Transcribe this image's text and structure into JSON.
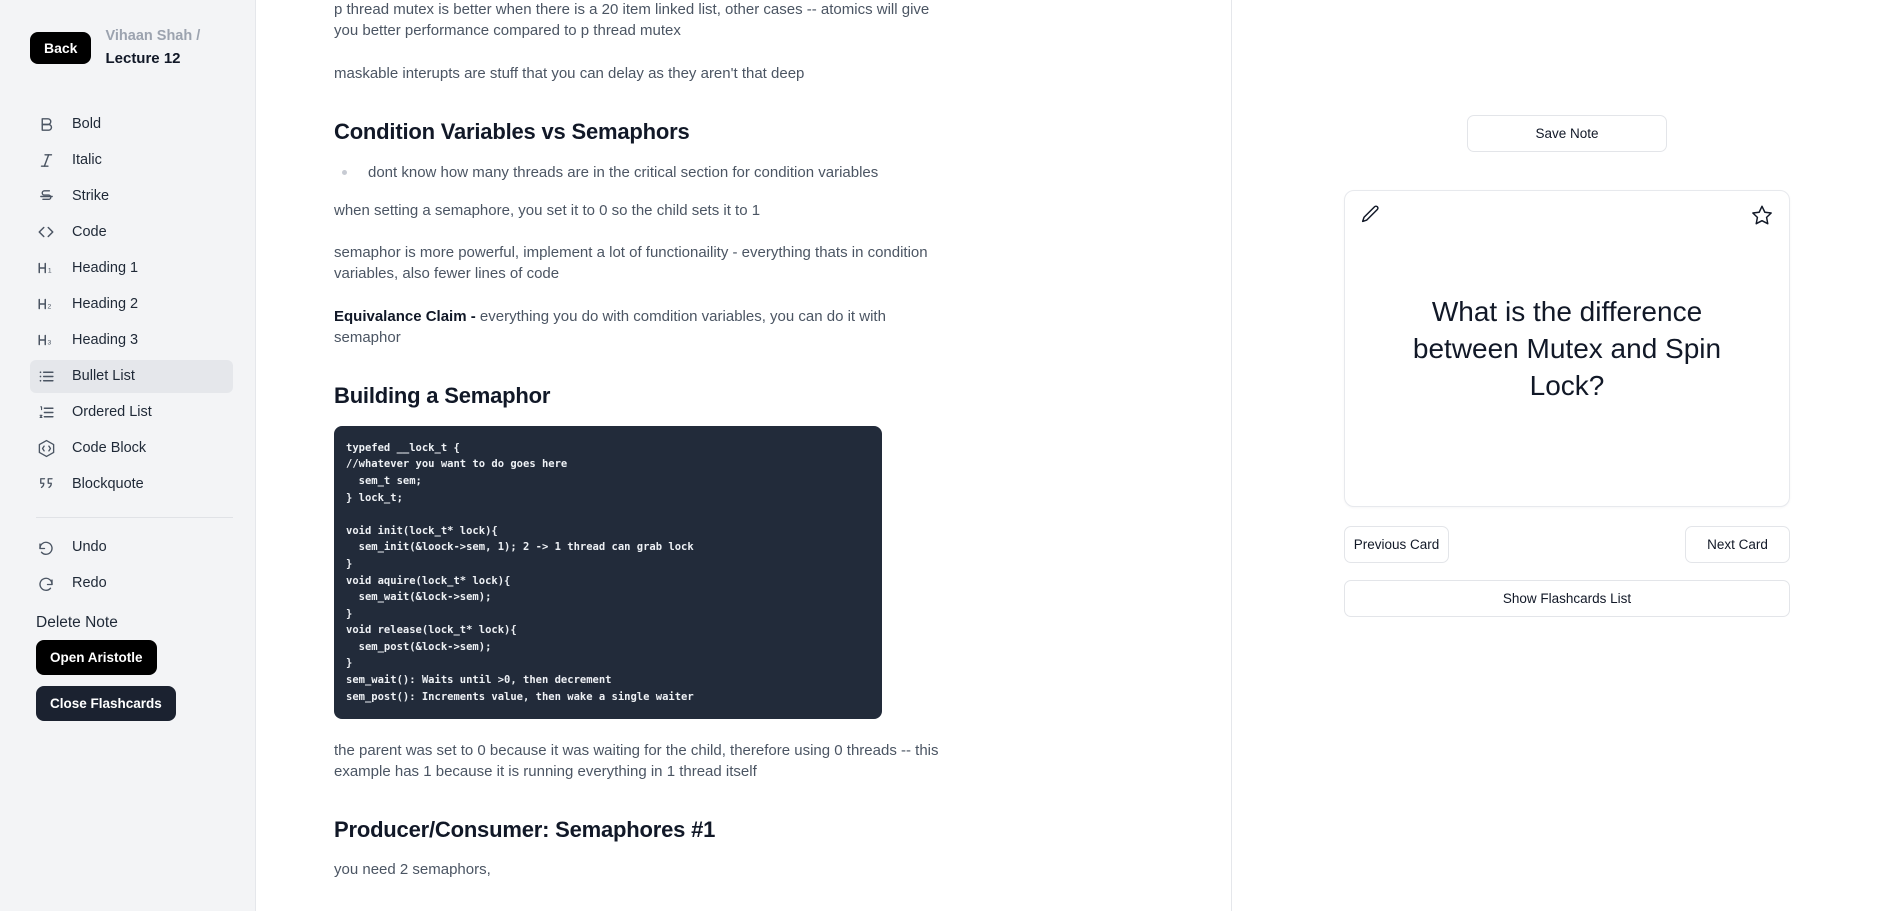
{
  "sidebar": {
    "back_label": "Back",
    "owner": "Vihaan Shah",
    "separator": "/",
    "note_title": "Lecture 12",
    "tools": [
      {
        "label": "Bold",
        "icon": "bold-icon",
        "active": false
      },
      {
        "label": "Italic",
        "icon": "italic-icon",
        "active": false
      },
      {
        "label": "Strike",
        "icon": "strikethrough-icon",
        "active": false
      },
      {
        "label": "Code",
        "icon": "code-icon",
        "active": false
      },
      {
        "label": "Heading 1",
        "icon": "heading-1-icon",
        "active": false
      },
      {
        "label": "Heading 2",
        "icon": "heading-2-icon",
        "active": false
      },
      {
        "label": "Heading 3",
        "icon": "heading-3-icon",
        "active": false
      },
      {
        "label": "Bullet List",
        "icon": "bullet-list-icon",
        "active": true
      },
      {
        "label": "Ordered List",
        "icon": "ordered-list-icon",
        "active": false
      },
      {
        "label": "Code Block",
        "icon": "code-block-icon",
        "active": false
      },
      {
        "label": "Blockquote",
        "icon": "blockquote-icon",
        "active": false
      },
      {
        "label": "Undo",
        "icon": "undo-icon",
        "active": false
      },
      {
        "label": "Redo",
        "icon": "redo-icon",
        "active": false
      }
    ],
    "delete_note_label": "Delete Note",
    "open_aristotle_label": "Open Aristotle",
    "close_flashcards_label": "Close Flashcards"
  },
  "editor": {
    "para_1": "p thread mutex is better when there is a 20 item linked list, other cases -- atomics will give you better performance compared to p thread mutex",
    "para_2": "maskable interupts are stuff that you can delay as they aren't that deep",
    "heading_1": "Condition Variables vs Semaphors",
    "bullet_1": "dont know how many threads are in the critical section for condition variables",
    "para_3": "when setting a semaphore, you set it to 0 so the child sets it to 1",
    "para_4": "semaphor is more powerful, implement a lot of functionaility - everything thats in condition variables, also fewer lines of code",
    "para_5_strong": "Equivalance Claim - ",
    "para_5_rest": "everything you do with comdition variables, you can do it with semaphor",
    "heading_2": "Building a Semaphor",
    "code_lines": [
      "typefed __lock_t {",
      "//whatever you want to do goes here",
      "  sem_t sem;",
      "} lock_t;",
      "",
      "void init(lock_t* lock){",
      "  sem_init(&loock->sem, 1); 2 -> 1 thread can grab lock",
      "}",
      "void aquire(lock_t* lock){",
      "  sem_wait(&lock->sem);",
      "}",
      "void release(lock_t* lock){",
      "  sem_post(&lock->sem);",
      "}",
      "sem_wait(): Waits until >0, then decrement",
      "sem_post(): Increments value, then wake a single waiter"
    ],
    "para_6": "the parent was set to 0 because it was waiting for the child, therefore using 0 threads -- this example has 1 because it is running everything in 1 thread itself",
    "heading_3": "Producer/Consumer: Semaphores #1",
    "para_7": "you need 2 semaphors,"
  },
  "flashcards": {
    "save_note_label": "Save Note",
    "card_question": "What is the difference between Mutex and Spin Lock?",
    "edit_icon": "pencil-icon",
    "star_icon": "star-outline-icon",
    "previous_card_label": "Previous Card",
    "next_card_label": "Next Card",
    "show_list_label": "Show Flashcards List"
  },
  "colors": {
    "sidebar_bg": "#f3f4f6",
    "accent_dark": "#000000",
    "flashcards_btn": "#1b2230",
    "code_bg": "#222b3a",
    "body_text": "#4b5563",
    "heading_text": "#111827"
  }
}
